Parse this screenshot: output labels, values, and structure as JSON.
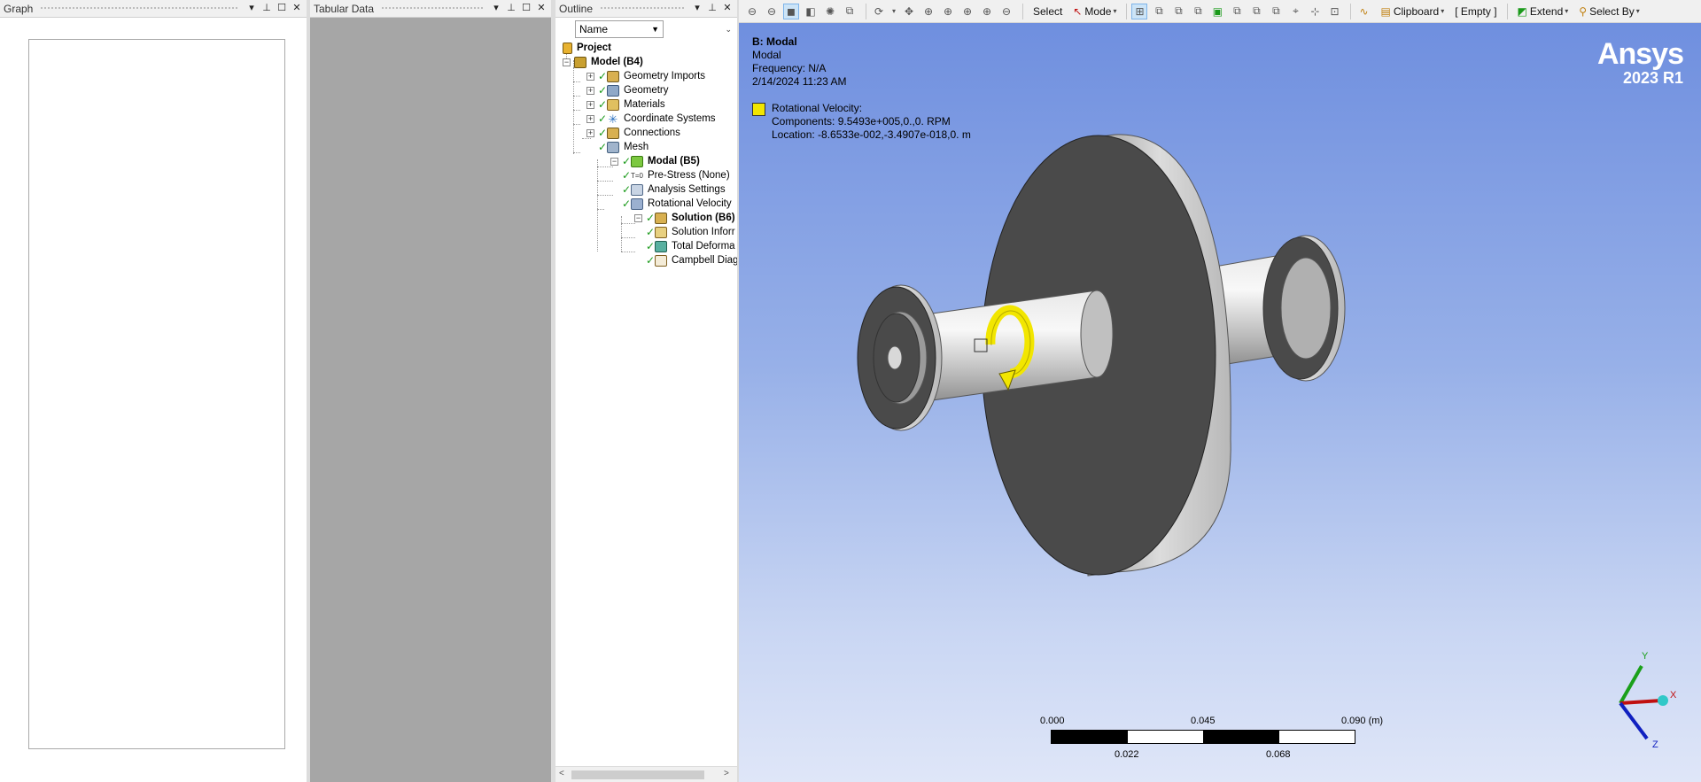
{
  "panels": {
    "graph": {
      "title": "Graph"
    },
    "tabular": {
      "title": "Tabular Data"
    },
    "outline": {
      "title": "Outline",
      "filter_value": "Name",
      "tree": [
        {
          "label": "Project",
          "bold": true
        },
        {
          "label": "Model (B4)",
          "bold": true
        },
        {
          "label": "Geometry Imports",
          "bold": false
        },
        {
          "label": "Geometry",
          "bold": false
        },
        {
          "label": "Materials",
          "bold": false
        },
        {
          "label": "Coordinate Systems",
          "bold": false
        },
        {
          "label": "Connections",
          "bold": false
        },
        {
          "label": "Mesh",
          "bold": false
        },
        {
          "label": "Modal (B5)",
          "bold": true
        },
        {
          "label": "Pre-Stress (None)",
          "bold": false
        },
        {
          "label": "Analysis Settings",
          "bold": false
        },
        {
          "label": "Rotational Velocity",
          "bold": false
        },
        {
          "label": "Solution (B6)",
          "bold": true
        },
        {
          "label": "Solution Inforr",
          "bold": false
        },
        {
          "label": "Total Deforma",
          "bold": false
        },
        {
          "label": "Campbell Diagi",
          "bold": false
        }
      ]
    }
  },
  "toolbar": {
    "select_label": "Select",
    "mode_label": "Mode",
    "clipboard_label": "Clipboard",
    "empty_label": "[ Empty ]",
    "extend_label": "Extend",
    "select_by_label": "Select By"
  },
  "viewport": {
    "title": "B: Modal",
    "subtitle": "Modal",
    "frequency": "Frequency: N/A",
    "date": "2/14/2024 11:23 AM",
    "legend": {
      "label": "Rotational Velocity:",
      "components": "Components: 9.5493e+005,0.,0. RPM",
      "location": "Location: -8.6533e-002,-3.4907e-018,0. m",
      "color": "#f2e600"
    },
    "brand": {
      "logo": "Ansys",
      "version": "2023 R1"
    },
    "scale": {
      "top_labels": [
        "0.000",
        "0.045",
        "0.090 (m)"
      ],
      "bottom_labels": [
        "0.022",
        "0.068"
      ]
    },
    "triad": {
      "x": "X",
      "y": "Y",
      "z": "Z"
    }
  }
}
